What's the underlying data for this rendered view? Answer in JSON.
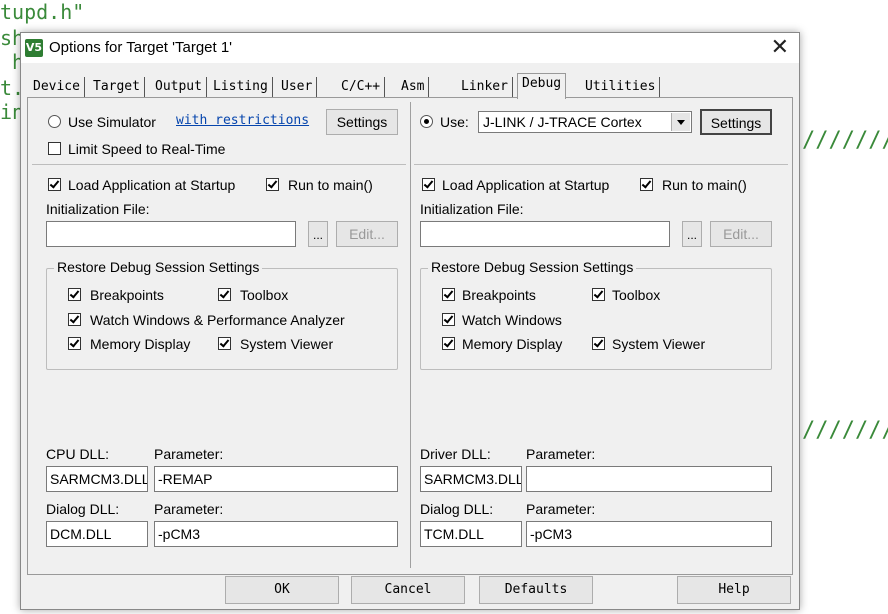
{
  "background_code": {
    "line1": "tupd.h\"",
    "line2": "sh",
    "line3": " h",
    "line4": "t.",
    "line5": "in",
    "right_slashes": "///////"
  },
  "dialog": {
    "title": "Options for Target 'Target 1'",
    "title_icon_text": "V5",
    "close_glyph": "✕"
  },
  "tabs": [
    "Device",
    "Target",
    "Output",
    "Listing",
    "User",
    "C/C++",
    "Asm",
    "Linker",
    "Debug",
    "Utilities"
  ],
  "left": {
    "use_simulator_label": "Use Simulator",
    "restrictions_link": "with restrictions",
    "settings_label": "Settings",
    "limit_speed_label": "Limit Speed to Real-Time",
    "load_app_label": "Load Application at Startup",
    "run_to_main_label": "Run to main()",
    "init_file_label": "Initialization File:",
    "browse_label": "...",
    "edit_label": "Edit...",
    "restore_group_label": "Restore Debug Session Settings",
    "breakpoints_label": "Breakpoints",
    "toolbox_label": "Toolbox",
    "watch_label": "Watch Windows & Performance Analyzer",
    "memory_label": "Memory Display",
    "sysviewer_label": "System Viewer",
    "cpu_dll_label": "CPU DLL:",
    "parameter_label": "Parameter:",
    "cpu_dll_value": "SARMCM3.DLL",
    "cpu_param_value": "-REMAP",
    "dialog_dll_label": "Dialog DLL:",
    "dialog_dll_value": "DCM.DLL",
    "dialog_param_value": "-pCM3"
  },
  "right": {
    "use_label": "Use:",
    "debugger_value": "J-LINK / J-TRACE Cortex",
    "settings_label": "Settings",
    "load_app_label": "Load Application at Startup",
    "run_to_main_label": "Run to main()",
    "init_file_label": "Initialization File:",
    "browse_label": "...",
    "edit_label": "Edit...",
    "restore_group_label": "Restore Debug Session Settings",
    "breakpoints_label": "Breakpoints",
    "toolbox_label": "Toolbox",
    "watch_label": "Watch Windows",
    "memory_label": "Memory Display",
    "sysviewer_label": "System Viewer",
    "driver_dll_label": "Driver DLL:",
    "parameter_label": "Parameter:",
    "driver_dll_value": "SARMCM3.DLL",
    "driver_param_value": "",
    "dialog_dll_label": "Dialog DLL:",
    "dialog_dll_value": "TCM.DLL",
    "dialog_param_value": "-pCM3"
  },
  "footer": {
    "ok_label": "OK",
    "cancel_label": "Cancel",
    "defaults_label": "Defaults",
    "help_label": "Help"
  }
}
